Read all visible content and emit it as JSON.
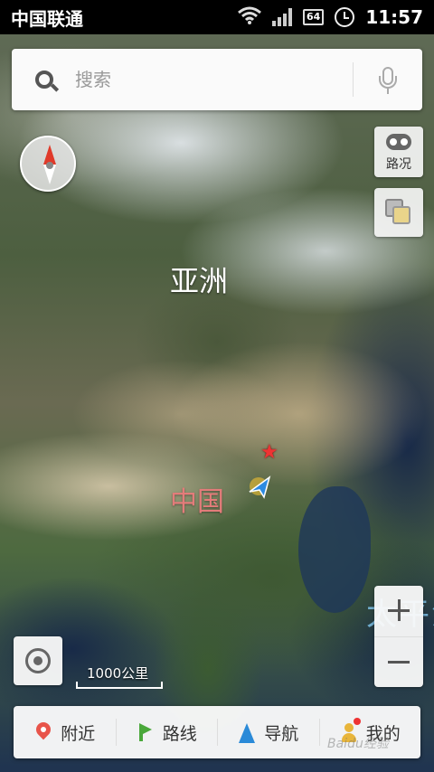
{
  "status_bar": {
    "carrier": "中国联通",
    "battery": "64",
    "time": "11:57"
  },
  "search": {
    "placeholder": "搜索"
  },
  "side_buttons": {
    "traffic_label": "路况"
  },
  "map": {
    "labels": {
      "continent": "亚洲",
      "country": "中国",
      "ocean_partial": "太平洋"
    },
    "scale_label": "1000公里"
  },
  "bottom_nav": {
    "items": [
      {
        "label": "附近",
        "icon": "pin-icon",
        "color": "#e8544a"
      },
      {
        "label": "路线",
        "icon": "route-icon",
        "color": "#4aa83a"
      },
      {
        "label": "导航",
        "icon": "navigation-arrow-icon",
        "color": "#2a8ad8"
      },
      {
        "label": "我的",
        "icon": "person-icon",
        "color": "#e8b53a"
      }
    ]
  },
  "watermark": "Baidu经验"
}
